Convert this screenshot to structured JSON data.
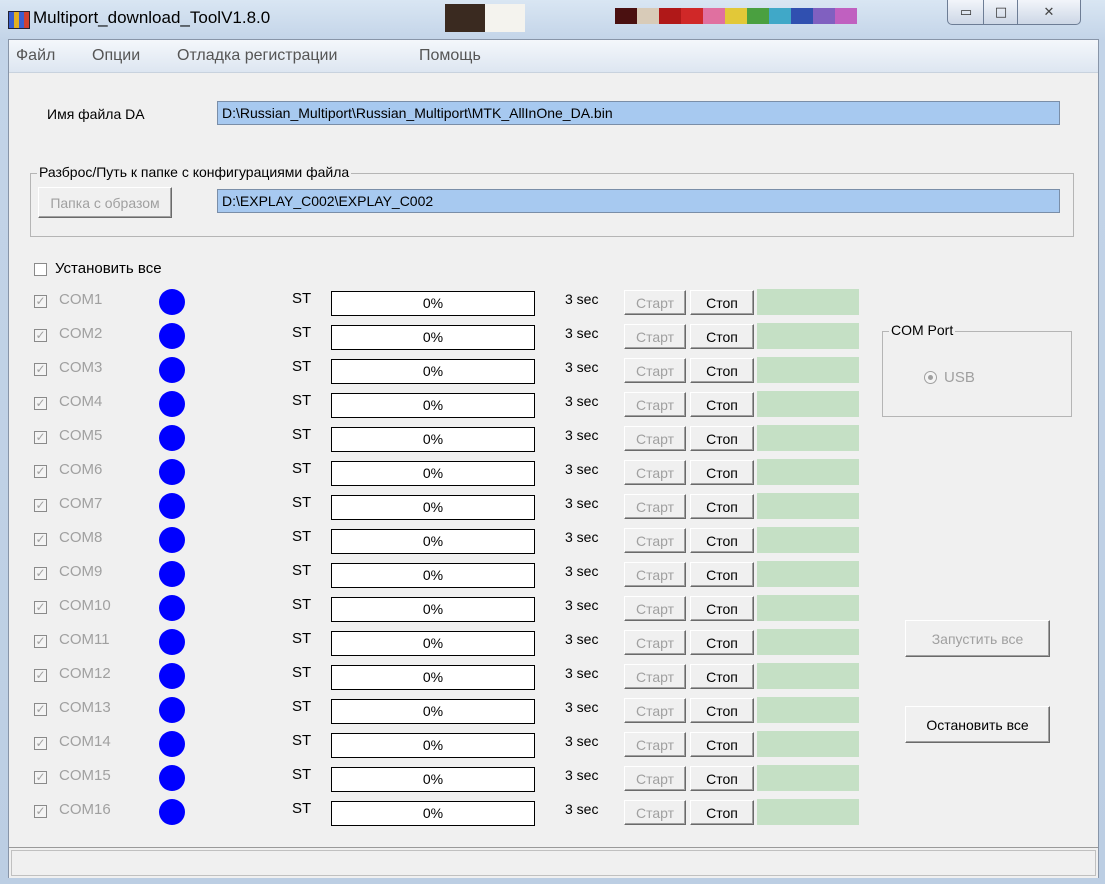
{
  "window": {
    "title": "Multiport_download_ToolV1.8.0",
    "icons": {
      "app": "app-icon",
      "minimize": "minimize-icon",
      "maximize": "maximize-icon",
      "close": "close-icon"
    },
    "minimize_glyph": "▭",
    "maximize_glyph": "□",
    "close_glyph": "✕"
  },
  "menu": [
    "Файл",
    "Опции",
    "Отладка регистрации",
    "Помощь"
  ],
  "da": {
    "label": "Имя файла DA",
    "value": "D:\\Russian_Multiport\\Russian_Multiport\\MTK_AllInOne_DA.bin"
  },
  "scatter": {
    "group_title": "Разброс/Путь к папке с конфигурациями файла",
    "button_label": "Папка с образом",
    "value": "D:\\EXPLAY_C002\\EXPLAY_C002"
  },
  "set_all": {
    "label": "Установить все",
    "checked": false
  },
  "ports": [
    {
      "name": "COM1",
      "status": "ST",
      "progress": "0%",
      "time": "3 sec",
      "start": "Старт",
      "stop": "Стоп"
    },
    {
      "name": "COM2",
      "status": "ST",
      "progress": "0%",
      "time": "3 sec",
      "start": "Старт",
      "stop": "Стоп"
    },
    {
      "name": "COM3",
      "status": "ST",
      "progress": "0%",
      "time": "3 sec",
      "start": "Старт",
      "stop": "Стоп"
    },
    {
      "name": "COM4",
      "status": "ST",
      "progress": "0%",
      "time": "3 sec",
      "start": "Старт",
      "stop": "Стоп"
    },
    {
      "name": "COM5",
      "status": "ST",
      "progress": "0%",
      "time": "3 sec",
      "start": "Старт",
      "stop": "Стоп"
    },
    {
      "name": "COM6",
      "status": "ST",
      "progress": "0%",
      "time": "3 sec",
      "start": "Старт",
      "stop": "Стоп"
    },
    {
      "name": "COM7",
      "status": "ST",
      "progress": "0%",
      "time": "3 sec",
      "start": "Старт",
      "stop": "Стоп"
    },
    {
      "name": "COM8",
      "status": "ST",
      "progress": "0%",
      "time": "3 sec",
      "start": "Старт",
      "stop": "Стоп"
    },
    {
      "name": "COM9",
      "status": "ST",
      "progress": "0%",
      "time": "3 sec",
      "start": "Старт",
      "stop": "Стоп"
    },
    {
      "name": "COM10",
      "status": "ST",
      "progress": "0%",
      "time": "3 sec",
      "start": "Старт",
      "stop": "Стоп"
    },
    {
      "name": "COM11",
      "status": "ST",
      "progress": "0%",
      "time": "3 sec",
      "start": "Старт",
      "stop": "Стоп"
    },
    {
      "name": "COM12",
      "status": "ST",
      "progress": "0%",
      "time": "3 sec",
      "start": "Старт",
      "stop": "Стоп"
    },
    {
      "name": "COM13",
      "status": "ST",
      "progress": "0%",
      "time": "3 sec",
      "start": "Старт",
      "stop": "Стоп"
    },
    {
      "name": "COM14",
      "status": "ST",
      "progress": "0%",
      "time": "3 sec",
      "start": "Старт",
      "stop": "Стоп"
    },
    {
      "name": "COM15",
      "status": "ST",
      "progress": "0%",
      "time": "3 sec",
      "start": "Старт",
      "stop": "Стоп"
    },
    {
      "name": "COM16",
      "status": "ST",
      "progress": "0%",
      "time": "3 sec",
      "start": "Старт",
      "stop": "Стоп"
    }
  ],
  "port_check_glyph": "✓",
  "com_port": {
    "group_title": "COM Port",
    "option": "USB",
    "selected": true
  },
  "actions": {
    "start_all": "Запустить все",
    "stop_all": "Остановить все"
  },
  "colors": {
    "led": "#0000ff",
    "field_bg": "#a7c9f0",
    "status_cell": "#c5e0c5",
    "disabled_text": "#a0a0a0"
  }
}
